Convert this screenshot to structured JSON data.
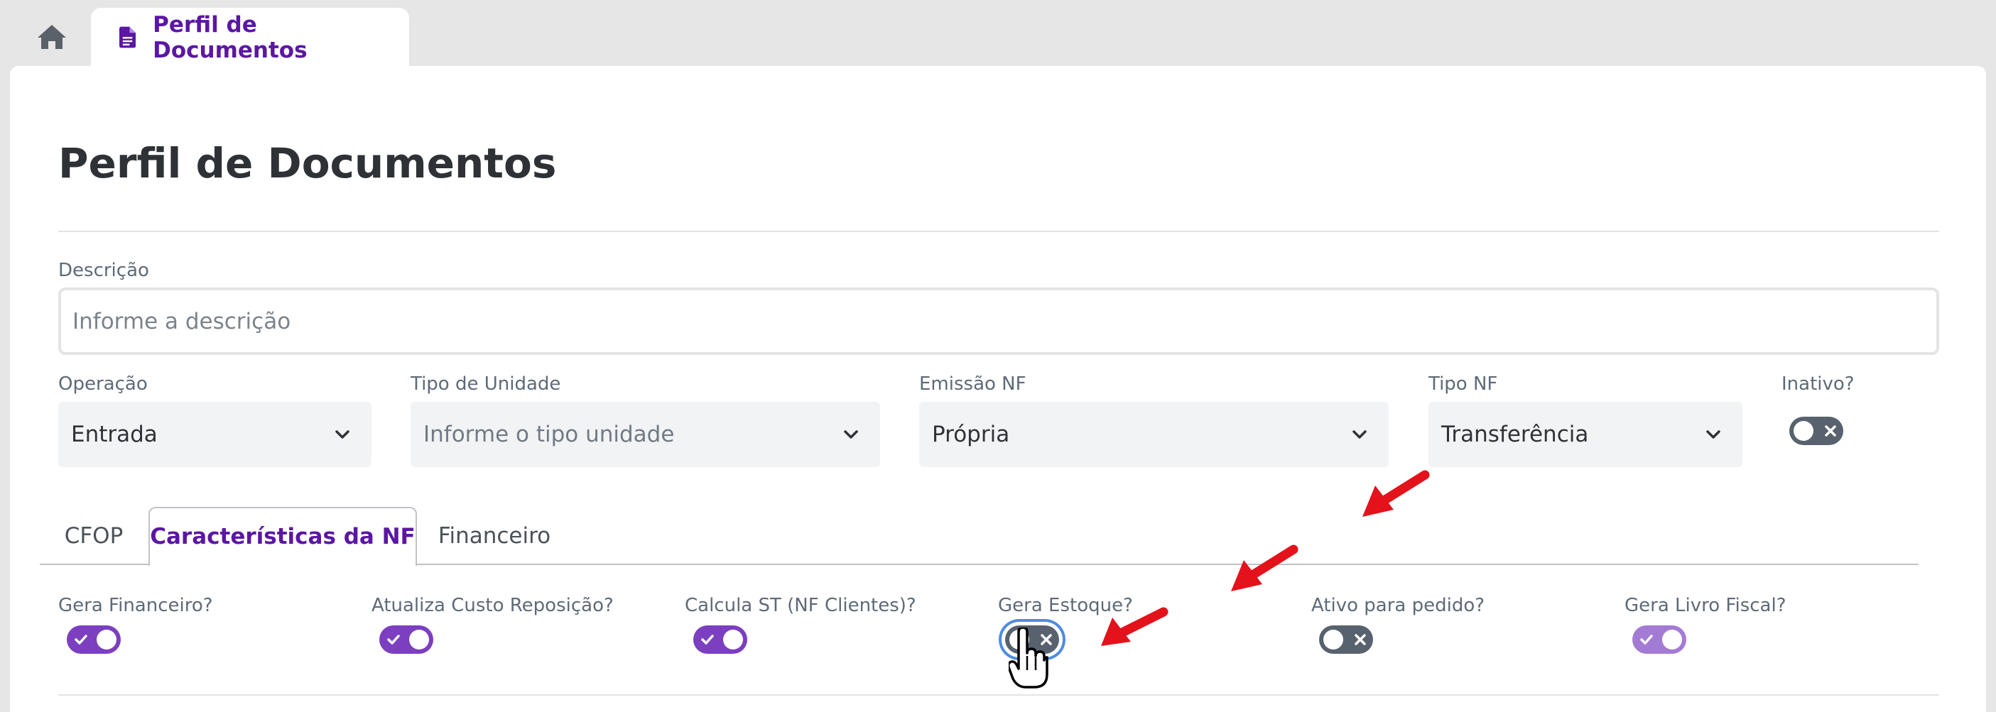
{
  "top_tabs": {
    "home_icon": "home-icon",
    "document_tab": {
      "label": "Perfil de Documentos",
      "icon": "file-document-icon"
    }
  },
  "page": {
    "title": "Perfil de Documentos"
  },
  "form": {
    "descricao": {
      "label": "Descrição",
      "placeholder": "Informe a descrição",
      "value": ""
    },
    "operacao": {
      "label": "Operação",
      "value": "Entrada"
    },
    "tipo_unidade": {
      "label": "Tipo de Unidade",
      "placeholder": "Informe o tipo unidade"
    },
    "emissao_nf": {
      "label": "Emissão NF",
      "value": "Própria"
    },
    "tipo_nf": {
      "label": "Tipo NF",
      "value": "Transferência"
    },
    "inativo": {
      "label": "Inativo?",
      "state": "off"
    }
  },
  "subtabs": [
    {
      "label": "CFOP",
      "active": false
    },
    {
      "label": "Características da NF",
      "active": true
    },
    {
      "label": "Financeiro",
      "active": false
    }
  ],
  "characteristics": [
    {
      "label": "Gera Financeiro?",
      "state": "on"
    },
    {
      "label": "Atualiza Custo Reposição?",
      "state": "on"
    },
    {
      "label": "Calcula ST (NF Clientes)?",
      "state": "on"
    },
    {
      "label": "Gera Estoque?",
      "state": "off"
    },
    {
      "label": "Ativo para pedido?",
      "state": "off"
    },
    {
      "label": "Gera Livro Fiscal?",
      "state": "on"
    }
  ],
  "colors": {
    "accent": "#5b17a3",
    "toggle_on": "#7b3fc0",
    "toggle_off": "#58626e",
    "annotation_arrow": "#e3121b",
    "focus_ring": "#4d8de0"
  }
}
